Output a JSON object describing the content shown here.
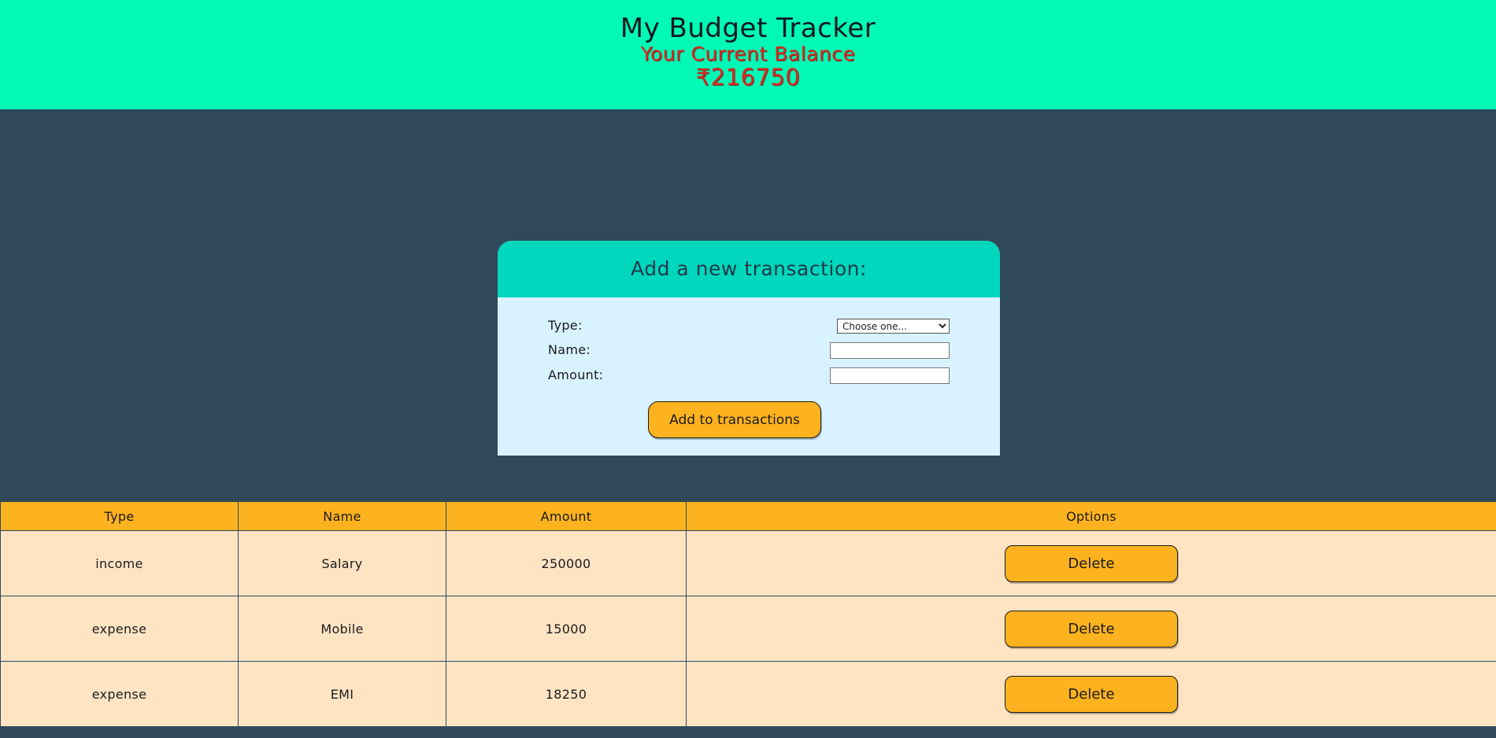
{
  "header": {
    "title": "My Budget Tracker",
    "balance_label": "Your Current Balance",
    "balance_value": "₹216750"
  },
  "form": {
    "heading": "Add a new transaction:",
    "type_label": "Type:",
    "type_selected": "Choose one...",
    "name_label": "Name:",
    "name_value": "",
    "amount_label": "Amount:",
    "amount_value": "",
    "submit_label": "Add to transactions"
  },
  "table": {
    "headers": [
      "Type",
      "Name",
      "Amount",
      "Options"
    ],
    "rows": [
      {
        "type": "income",
        "name": "Salary",
        "amount": "250000",
        "action": "Delete"
      },
      {
        "type": "expense",
        "name": "Mobile",
        "amount": "15000",
        "action": "Delete"
      },
      {
        "type": "expense",
        "name": "EMI",
        "amount": "18250",
        "action": "Delete"
      }
    ]
  },
  "colors": {
    "header_bg": "#00fab6",
    "page_bg": "#30495a",
    "card_header_bg": "#00d7bd",
    "card_body_bg": "#d8f3ff",
    "accent": "#fdb21f",
    "row_bg": "#ffe4c4",
    "balance_text": "#d62a1e"
  }
}
